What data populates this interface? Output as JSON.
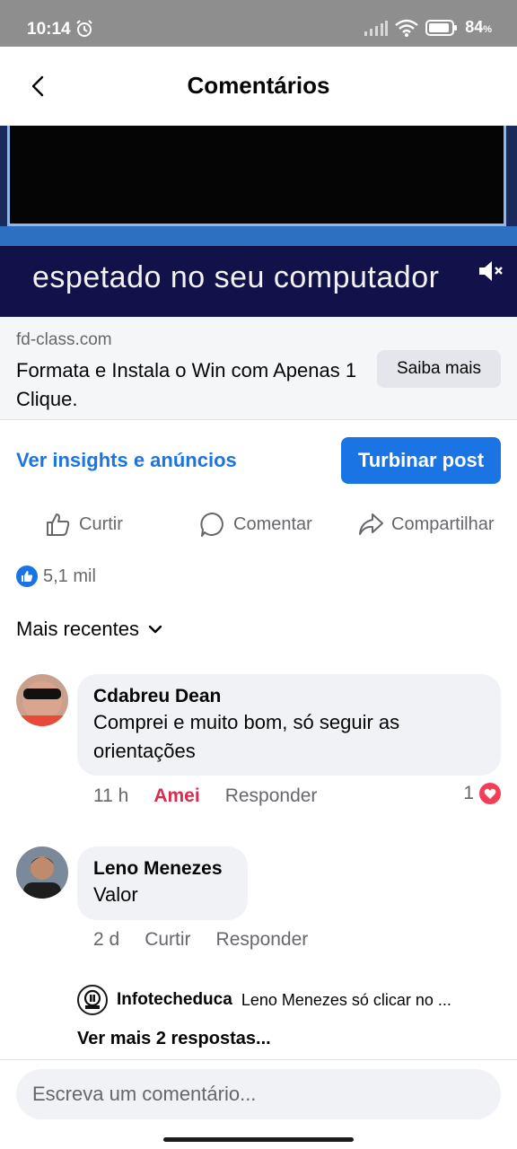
{
  "status_bar": {
    "time": "10:14",
    "battery": "84",
    "icons": [
      "alarm-icon",
      "signal-icon",
      "wifi-icon",
      "battery-icon"
    ]
  },
  "header": {
    "title": "Comentários",
    "back_icon": "chevron-left-icon"
  },
  "ad": {
    "video_caption": "espetado no seu computador",
    "domain": "fd-class.com",
    "headline": "Formata e Instala o Win com Apenas 1 Clique.",
    "cta_label": "Saiba mais"
  },
  "promo": {
    "insights_label": "Ver insights e anúncios",
    "boost_label": "Turbinar post"
  },
  "actions": {
    "like_label": "Curtir",
    "comment_label": "Comentar",
    "share_label": "Compartilhar"
  },
  "reactions": {
    "count": "5,1 mil"
  },
  "sort": {
    "label": "Mais recentes"
  },
  "comments": [
    {
      "author": "Cdabreu Dean",
      "text": "Comprei e muito bom,  só seguir as orientações",
      "time": "11 h",
      "reaction_label": "Amei",
      "reply_label": "Responder",
      "reaction_count": "1"
    },
    {
      "author": "Leno Menezes",
      "text": "Valor",
      "time": "2 d",
      "reaction_label": "Curtir",
      "reply_label": "Responder",
      "reply_preview": {
        "author": "Infotecheduca",
        "text": "Leno Menezes só clicar no ..."
      },
      "more_replies": "Ver mais 2 respostas..."
    }
  ],
  "composer": {
    "placeholder": "Escreva um comentário..."
  },
  "colors": {
    "accent": "#1b74e4",
    "love": "#d82d4c",
    "bubble": "#f0f2f5",
    "secondary_text": "#65676b"
  }
}
